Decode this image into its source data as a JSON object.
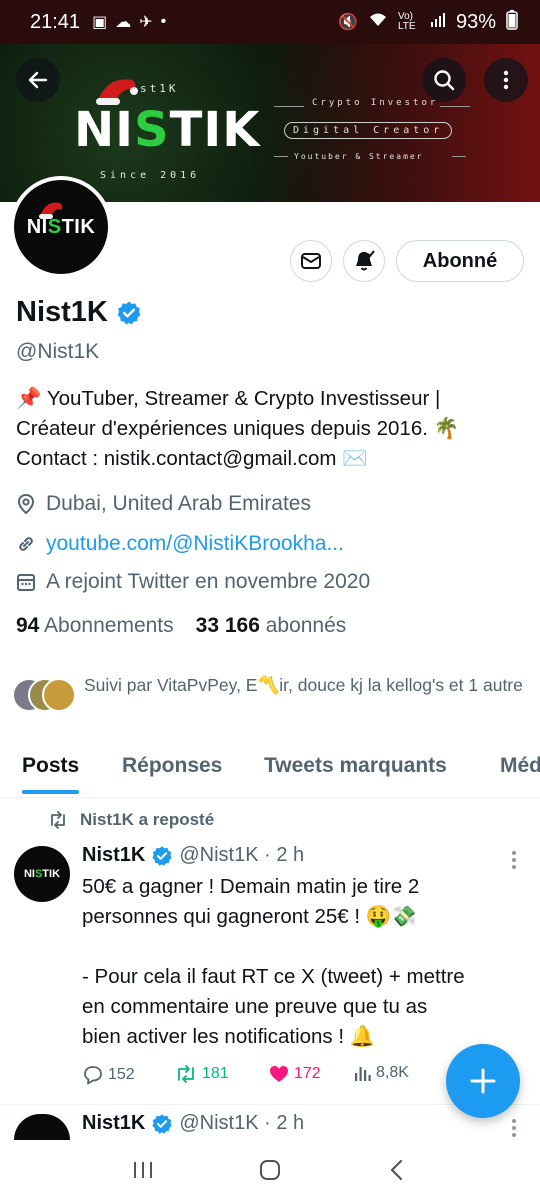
{
  "status_bar": {
    "time": "21:41",
    "battery": "93%",
    "network_label": "Vo) LTE"
  },
  "banner": {
    "logo_top": "st1K",
    "logo_main_a": "NI",
    "logo_main_s": "S",
    "logo_main_b": "TIK",
    "since": "Since 2016",
    "tagline_1": "Crypto Investor",
    "tagline_2": "Digital Creator",
    "tagline_3": "Youtuber & Streamer"
  },
  "avatar": {
    "text_a": "NI",
    "text_s": "S",
    "text_b": "TIK"
  },
  "actions": {
    "follow_label": "Abonné"
  },
  "profile": {
    "display_name": "Nist1K",
    "handle": "@Nist1K",
    "bio_line1": "📌 YouTuber, Streamer & Crypto Investisseur |",
    "bio_line2": "Créateur d'expériences uniques depuis 2016. 🌴",
    "bio_line3": "Contact : nistik.contact@gmail.com ✉️",
    "location": "Dubai, United Arab Emirates",
    "link": "youtube.com/@NistiKBrookha...",
    "joined": "A rejoint Twitter en novembre 2020",
    "following_count": "94",
    "following_label": "Abonnements",
    "followers_count": "33 166",
    "followers_label": "abonnés",
    "followed_by": "Suivi par VitaPvPey, E〽️ir, douce kj la kellog's et 1 autre"
  },
  "tabs": [
    {
      "label": "Posts"
    },
    {
      "label": "Réponses"
    },
    {
      "label": "Tweets marquants"
    },
    {
      "label": "Méd"
    }
  ],
  "post": {
    "repost_label": "Nist1K a reposté",
    "author_name": "Nist1K",
    "author_handle": "@Nist1K · 2 h",
    "avatar_text_a": "NI",
    "avatar_text_s": "S",
    "avatar_text_b": "TIK",
    "line1": "50€ a gagner ! Demain matin je tire 2",
    "line2": "personnes qui gagneront 25€ ! 🤑💸",
    "line3": "",
    "line4": "- Pour cela il faut RT ce X (tweet)  + mettre",
    "line5": "en commentaire une preuve que tu as",
    "line6": "bien activer les notifications ! 🔔",
    "replies": "152",
    "retweets": "181",
    "likes": "172",
    "views": "8,8K"
  },
  "post2": {
    "author_name": "Nist1K",
    "author_handle": "@Nist1K · 2 h"
  },
  "colors": {
    "accent": "#1d9bf0",
    "retweet_green": "#00ba7c",
    "like_pink": "#f91880",
    "secondary_text": "#536471"
  }
}
